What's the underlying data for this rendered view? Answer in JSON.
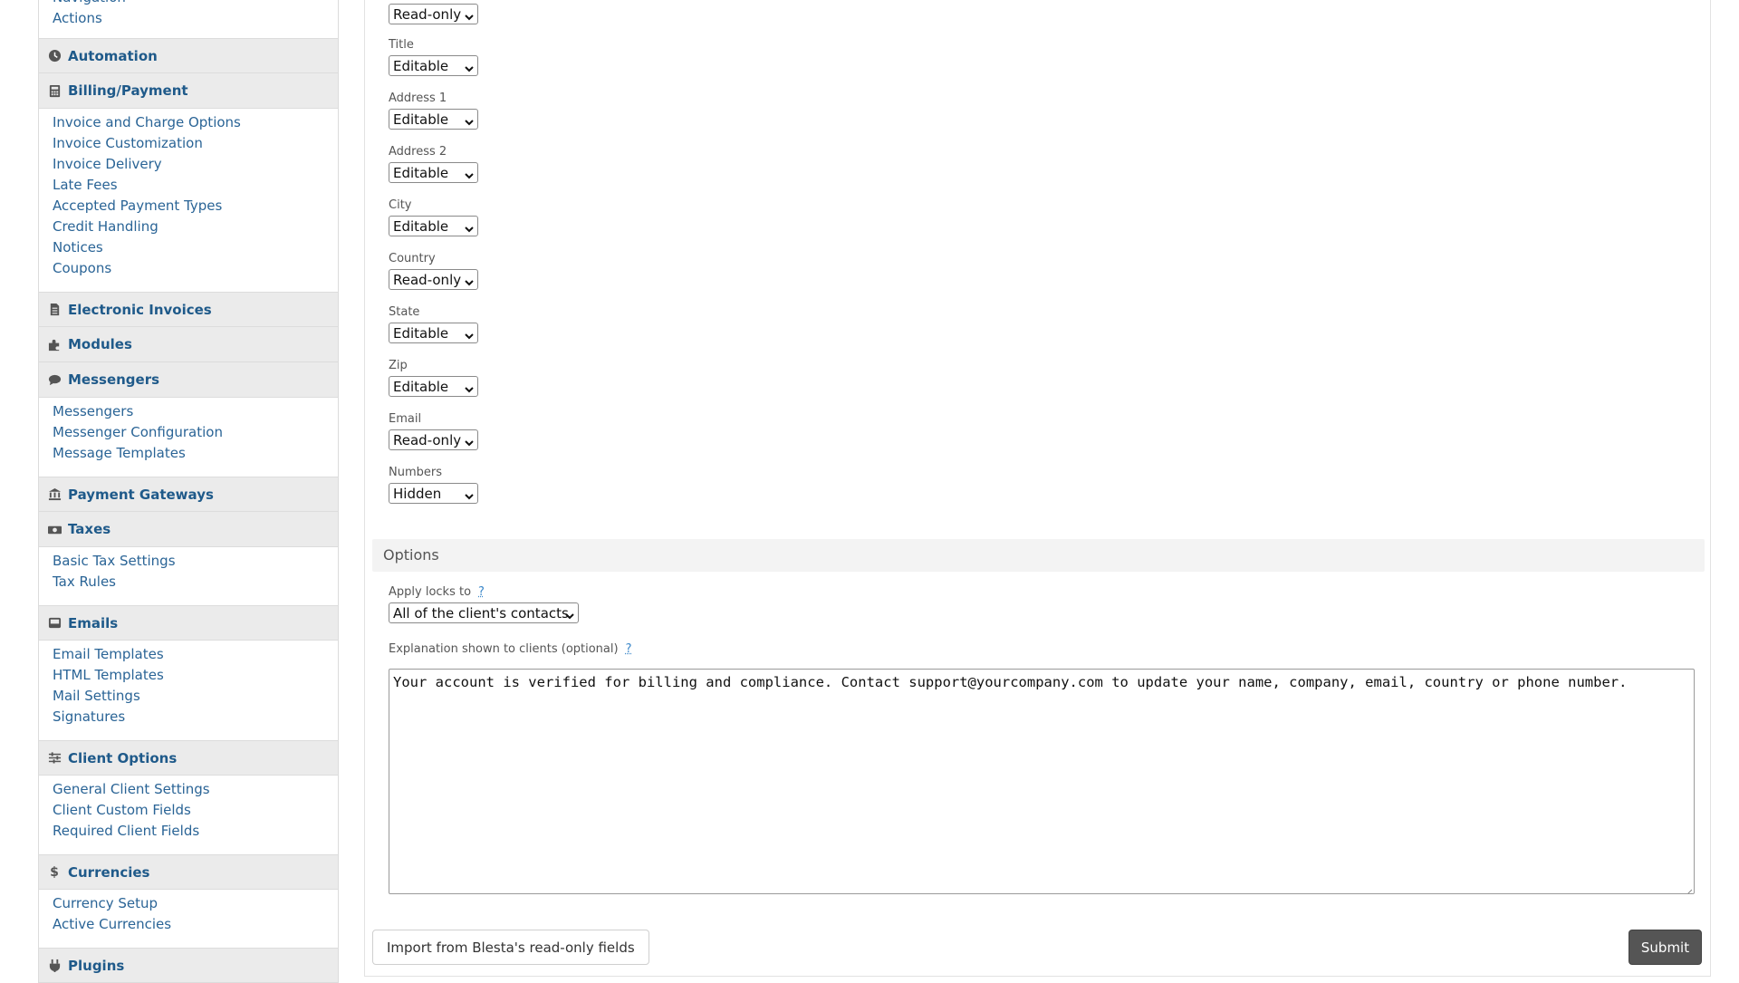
{
  "sidebar": {
    "top_links": [
      "Navigation",
      "Actions"
    ],
    "sections": [
      {
        "title": "Automation",
        "icon": "clock-icon",
        "links": []
      },
      {
        "title": "Billing/Payment",
        "icon": "calculator-icon",
        "links": [
          "Invoice and Charge Options",
          "Invoice Customization",
          "Invoice Delivery",
          "Late Fees",
          "Accepted Payment Types",
          "Credit Handling",
          "Notices",
          "Coupons"
        ]
      },
      {
        "title": "Electronic Invoices",
        "icon": "document-icon",
        "links": []
      },
      {
        "title": "Modules",
        "icon": "puzzle-icon",
        "links": []
      },
      {
        "title": "Messengers",
        "icon": "chat-bubble-icon",
        "links": [
          "Messengers",
          "Messenger Configuration",
          "Message Templates"
        ]
      },
      {
        "title": "Payment Gateways",
        "icon": "bank-icon",
        "links": []
      },
      {
        "title": "Taxes",
        "icon": "money-icon",
        "links": [
          "Basic Tax Settings",
          "Tax Rules"
        ]
      },
      {
        "title": "Emails",
        "icon": "inbox-icon",
        "links": [
          "Email Templates",
          "HTML Templates",
          "Mail Settings",
          "Signatures"
        ]
      },
      {
        "title": "Client Options",
        "icon": "sliders-icon",
        "links": [
          "General Client Settings",
          "Client Custom Fields",
          "Required Client Fields"
        ]
      },
      {
        "title": "Currencies",
        "icon": "dollar-icon",
        "links": [
          "Currency Setup",
          "Active Currencies"
        ]
      },
      {
        "title": "Plugins",
        "icon": "plug-icon",
        "links": []
      }
    ]
  },
  "fields": [
    {
      "label": "",
      "value": "Read-only"
    },
    {
      "label": "Title",
      "value": "Editable"
    },
    {
      "label": "Address 1",
      "value": "Editable"
    },
    {
      "label": "Address 2",
      "value": "Editable"
    },
    {
      "label": "City",
      "value": "Editable"
    },
    {
      "label": "Country",
      "value": "Read-only"
    },
    {
      "label": "State",
      "value": "Editable"
    },
    {
      "label": "Zip",
      "value": "Editable"
    },
    {
      "label": "Email",
      "value": "Read-only"
    },
    {
      "label": "Numbers",
      "value": "Hidden"
    }
  ],
  "options": {
    "heading": "Options",
    "apply_locks_label": "Apply locks to",
    "apply_locks_help": "?",
    "apply_locks_value": "All of the client's contacts",
    "explanation_label": "Explanation shown to clients (optional)",
    "explanation_help": "?",
    "explanation_value": "Your account is verified for billing and compliance. Contact support@yourcompany.com to update your name, company, email, country or phone number."
  },
  "buttons": {
    "import_label": "Import from Blesta's read-only fields",
    "submit_label": "Submit"
  },
  "colors": {
    "link": "#2a6496",
    "section_header_bg": "#ebebeb",
    "submit_bg": "#555555",
    "help": "#3a87c9"
  }
}
